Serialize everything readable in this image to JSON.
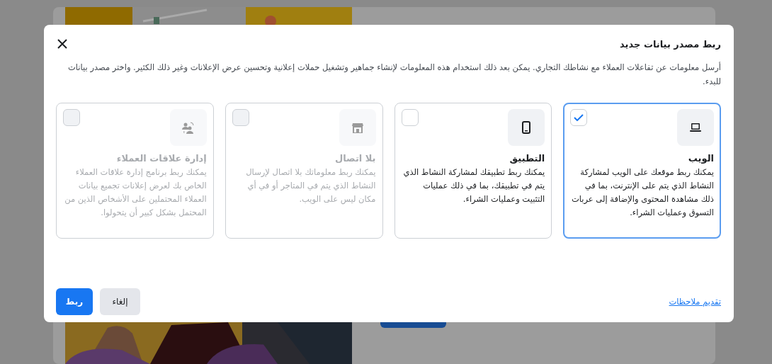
{
  "dialog": {
    "title": "ربط مصدر بيانات جديد",
    "description": "أرسل معلومات عن تفاعلات العملاء مع نشاطك التجاري. يمكن بعد ذلك استخدام هذه المعلومات لإنشاء جماهير وتشغيل حملات إعلانية وتحسين عرض الإعلانات وغير ذلك الكثير. واختر مصدر بيانات للبدء.",
    "sources": [
      {
        "kind": "web",
        "title": "الويب",
        "description": "يمكنك ربط موقعك على الويب لمشاركة النشاط الذي يتم على الإنترنت، بما في ذلك مشاهدة المحتوى والإضافة إلى عربات التسوق وعمليات الشراء.",
        "selected": true,
        "disabled": false
      },
      {
        "kind": "app",
        "title": "التطبيق",
        "description": "يمكنك ربط تطبيقك لمشاركة النشاط الذي يتم في تطبيقك، بما في ذلك عمليات التثبيت وعمليات الشراء.",
        "selected": false,
        "disabled": false
      },
      {
        "kind": "offline",
        "title": "بلا اتصال",
        "description": "يمكنك ربط معلوماتك بلا اتصال لإرسال النشاط الذي يتم في المتاجر أو في أي مكان ليس على الويب.",
        "selected": false,
        "disabled": true
      },
      {
        "kind": "crm",
        "title": "إدارة علاقات العملاء",
        "description": "يمكنك ربط برنامج إدارة علاقات العملاء الخاص بك لعرض إعلانات تجميع بيانات العملاء المحتملين على الأشخاص الذين من المحتمل بشكل كبير أن يتحولوا.",
        "selected": false,
        "disabled": true
      }
    ],
    "feedback_link": "تقديم ملاحظات",
    "buttons": [
      {
        "kind": "secondary",
        "label": "إلغاء"
      },
      {
        "kind": "primary",
        "label": "ربط"
      }
    ]
  }
}
